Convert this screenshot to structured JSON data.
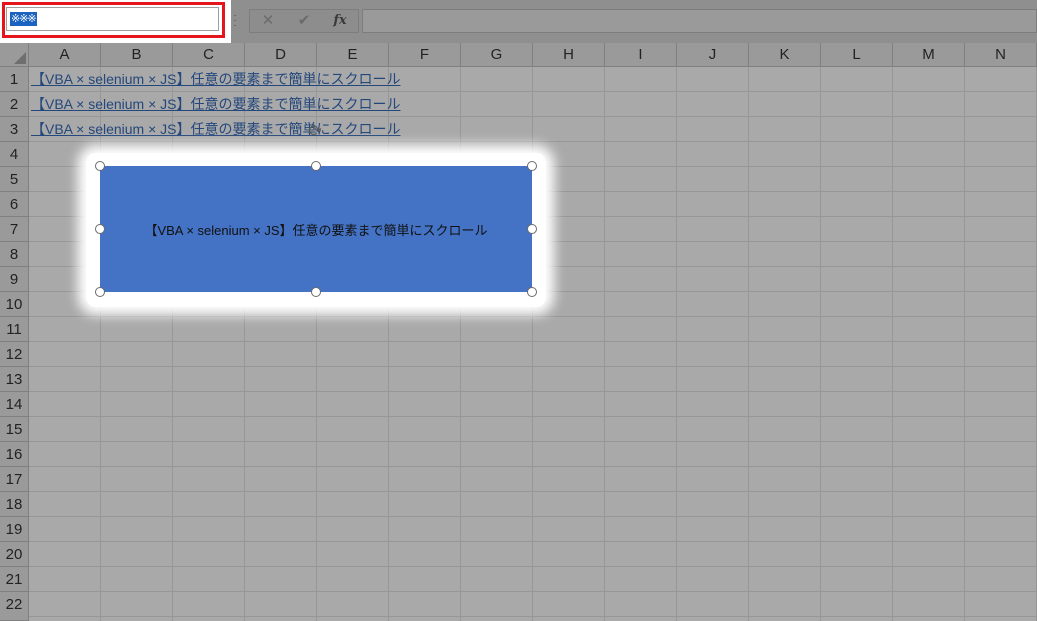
{
  "name_box": {
    "value": "※※※"
  },
  "formula_bar": {
    "cancel_label": "✕",
    "enter_label": "✔",
    "fx_label": "fx",
    "content": ""
  },
  "columns": [
    "A",
    "B",
    "C",
    "D",
    "E",
    "F",
    "G",
    "H",
    "I",
    "J",
    "K",
    "L",
    "M",
    "N"
  ],
  "rows": [
    "1",
    "2",
    "3",
    "4",
    "5",
    "6",
    "7",
    "8",
    "9",
    "10",
    "11",
    "12",
    "13",
    "14",
    "15",
    "16",
    "17",
    "18",
    "19",
    "20",
    "21",
    "22"
  ],
  "cells": {
    "a1": "【VBA × selenium × JS】任意の要素まで簡単にスクロール",
    "a2": "【VBA × selenium × JS】任意の要素まで簡単にスクロール",
    "a3": "【VBA × selenium × JS】任意の要素まで簡単にスクロール"
  },
  "shape": {
    "text": "【VBA × selenium × JS】任意の要素まで簡単にスクロール",
    "fill_color": "#4472c4"
  },
  "colors": {
    "highlight_border": "#e5161b",
    "link": "#24477c",
    "selection": "#1a63c0"
  },
  "icons": {
    "cancel": "x-icon",
    "enter": "check-icon",
    "function": "fx-icon",
    "rotate": "rotate-handle-icon"
  }
}
